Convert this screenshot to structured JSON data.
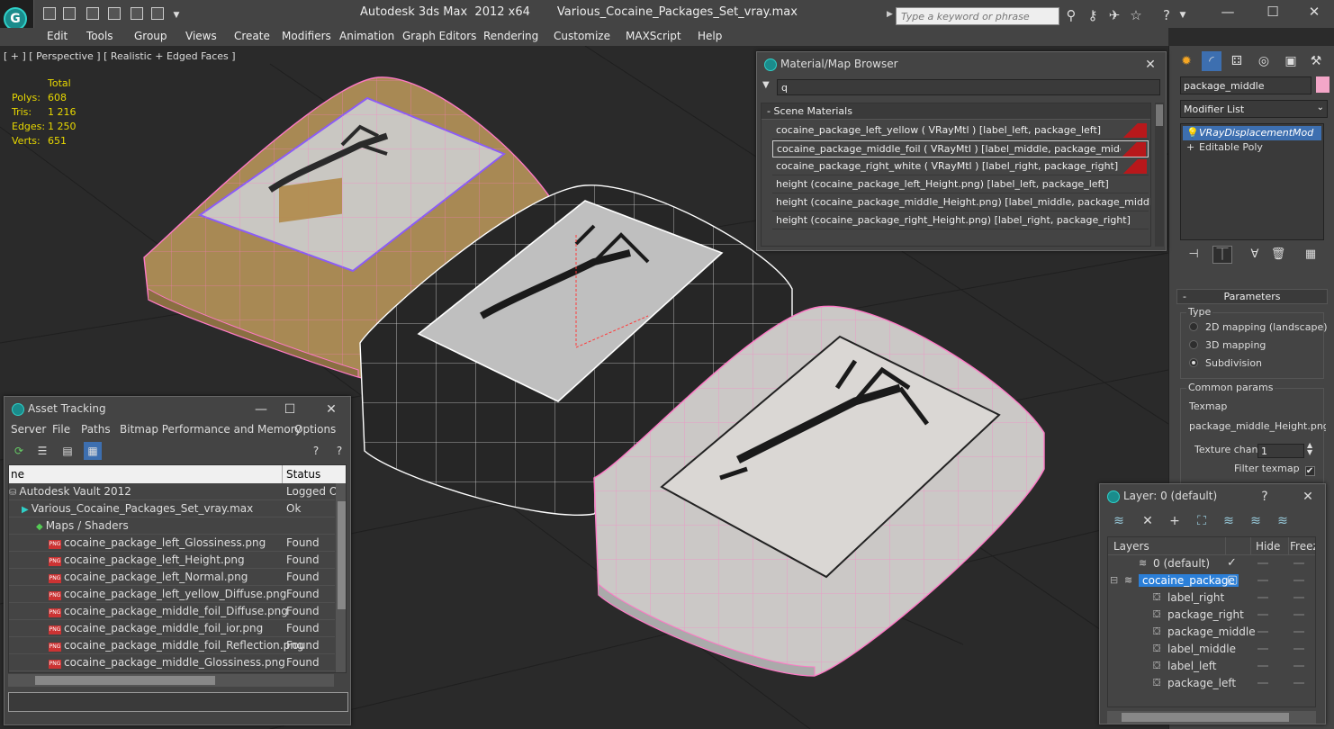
{
  "window": {
    "app_title": "Autodesk 3ds Max  2012 x64",
    "file_title": "Various_Cocaine_Packages_Set_vray.max",
    "search_placeholder": "Type a keyword or phrase",
    "app_logo": "3ds-max-logo"
  },
  "menu": [
    "Edit",
    "Tools",
    "Group",
    "Views",
    "Create",
    "Modifiers",
    "Animation",
    "Graph Editors",
    "Rendering",
    "Customize",
    "MAXScript",
    "Help"
  ],
  "viewport": {
    "label": "[ + ] [ Perspective ] [ Realistic + Edged Faces ]",
    "stats_header": "Total",
    "stats": [
      {
        "key": "Polys:",
        "value": "608"
      },
      {
        "key": "Tris:",
        "value": "1 216"
      },
      {
        "key": "Edges:",
        "value": "1 250"
      },
      {
        "key": "Verts:",
        "value": "651"
      }
    ]
  },
  "command_panel": {
    "object_name": "package_middle",
    "object_color": "#f4a6c8",
    "modifier_list_label": "Modifier List",
    "stack": [
      "VRayDisplacementMod",
      "Editable Poly"
    ],
    "parameters_title": "Parameters",
    "type_group": "Type",
    "type_options": [
      {
        "label": "2D mapping (landscape)",
        "selected": false
      },
      {
        "label": "3D mapping",
        "selected": false
      },
      {
        "label": "Subdivision",
        "selected": true
      }
    ],
    "common_params": "Common params",
    "texmap_label": "Texmap",
    "texmap_value": "package_middle_Height.png)",
    "texture_chan_label": "Texture chan",
    "texture_chan_value": "1",
    "filter_texmap_label": "Filter texmap",
    "filter_texmap_checked": "✔"
  },
  "material_browser": {
    "title": "Material/Map Browser",
    "search_value": "q",
    "section": "Scene Materials",
    "items": [
      {
        "label": "cocaine_package_left_yellow  ( VRayMtl )  [label_left, package_left]",
        "swatch": true,
        "selected": false
      },
      {
        "label": "cocaine_package_middle_foil  ( VRayMtl )  [label_middle, package_middle]",
        "swatch": true,
        "selected": true
      },
      {
        "label": "cocaine_package_right_white  ( VRayMtl )  [label_right, package_right]",
        "swatch": true,
        "selected": false
      },
      {
        "label": "height (cocaine_package_left_Height.png) [label_left, package_left]",
        "swatch": false,
        "selected": false
      },
      {
        "label": "height (cocaine_package_middle_Height.png) [label_middle, package_middle]",
        "swatch": false,
        "selected": false
      },
      {
        "label": "height (cocaine_package_right_Height.png) [label_right, package_right]",
        "swatch": false,
        "selected": false
      }
    ]
  },
  "asset_tracking": {
    "title": "Asset Tracking",
    "menu": [
      "Server",
      "File",
      "Paths",
      "Bitmap Performance and Memory",
      "Options"
    ],
    "columns": [
      "ne",
      "Status"
    ],
    "rows": [
      {
        "name": "Autodesk Vault 2012",
        "status": "Logged O",
        "indent": 0,
        "kind": "vault"
      },
      {
        "name": "Various_Cocaine_Packages_Set_vray.max",
        "status": "Ok",
        "indent": 1,
        "kind": "max"
      },
      {
        "name": "Maps / Shaders",
        "status": "",
        "indent": 2,
        "kind": "folder"
      },
      {
        "name": "cocaine_package_left_Glossiness.png",
        "status": "Found",
        "indent": 3,
        "kind": "png"
      },
      {
        "name": "cocaine_package_left_Height.png",
        "status": "Found",
        "indent": 3,
        "kind": "png"
      },
      {
        "name": "cocaine_package_left_Normal.png",
        "status": "Found",
        "indent": 3,
        "kind": "png"
      },
      {
        "name": "cocaine_package_left_yellow_Diffuse.png",
        "status": "Found",
        "indent": 3,
        "kind": "png"
      },
      {
        "name": "cocaine_package_middle_foil_Diffuse.png",
        "status": "Found",
        "indent": 3,
        "kind": "png"
      },
      {
        "name": "cocaine_package_middle_foil_ior.png",
        "status": "Found",
        "indent": 3,
        "kind": "png"
      },
      {
        "name": "cocaine_package_middle_foil_Reflection.png",
        "status": "Found",
        "indent": 3,
        "kind": "png"
      },
      {
        "name": "cocaine_package_middle_Glossiness.png",
        "status": "Found",
        "indent": 3,
        "kind": "png"
      }
    ]
  },
  "layer_dialog": {
    "title": "Layer: 0 (default)",
    "columns": [
      "Layers",
      "Hide",
      "Freeze"
    ],
    "rows": [
      {
        "name": "0 (default)",
        "indent": 1,
        "current": true,
        "selected": false
      },
      {
        "name": "cocaine_package",
        "indent": 0,
        "current": false,
        "selected": true
      },
      {
        "name": "label_right",
        "indent": 2,
        "current": false,
        "selected": false
      },
      {
        "name": "package_right",
        "indent": 2,
        "current": false,
        "selected": false
      },
      {
        "name": "package_middle",
        "indent": 2,
        "current": false,
        "selected": false
      },
      {
        "name": "label_middle",
        "indent": 2,
        "current": false,
        "selected": false
      },
      {
        "name": "label_left",
        "indent": 2,
        "current": false,
        "selected": false
      },
      {
        "name": "package_left",
        "indent": 2,
        "current": false,
        "selected": false
      }
    ]
  }
}
